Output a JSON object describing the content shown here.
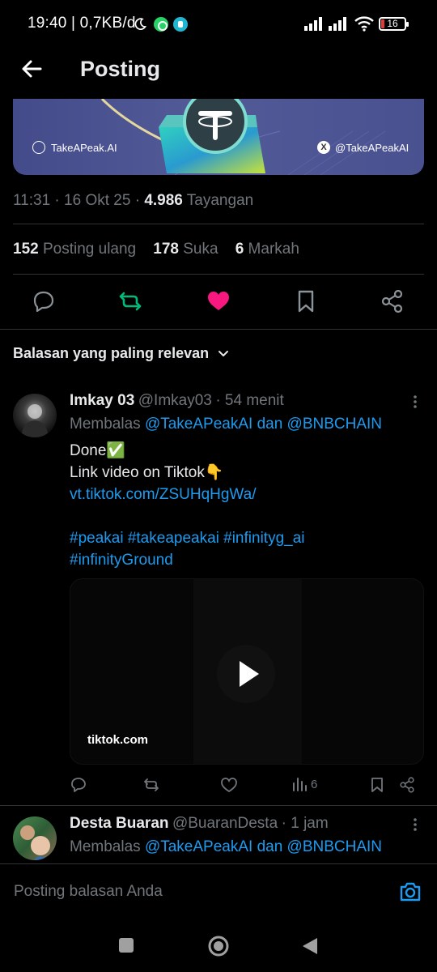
{
  "status_bar": {
    "text": "19:40 | 0,7KB/d",
    "battery": "16"
  },
  "header": {
    "title": "Posting"
  },
  "banner": {
    "website": "TakeAPeak.AI",
    "x_handle": "@TakeAPeakAI"
  },
  "post_meta": {
    "time": "11:31",
    "date": "16 Okt 25",
    "views_count": "4.986",
    "views_label": "Tayangan"
  },
  "post_stats": {
    "reposts_count": "152",
    "reposts_label": "Posting ulang",
    "likes_count": "178",
    "likes_label": "Suka",
    "bookmarks_count": "6",
    "bookmarks_label": "Markah"
  },
  "colors": {
    "accent_blue": "#1d9bf0",
    "repost_green": "#00ba7c",
    "like_pink": "#f91880"
  },
  "replies_filter": {
    "label": "Balasan yang paling relevan"
  },
  "replies": [
    {
      "name": "Imkay 03",
      "handle": "@Imkay03",
      "time": "54 menit",
      "replying_prefix": "Membalas",
      "replying_to": "@TakeAPeakAI dan @BNBCHAIN",
      "line1": "Done✅",
      "line2": "Link video on Tiktok👇",
      "link": "vt.tiktok.com/ZSUHqHgWa/",
      "hashtags1": "#peakai #takeapeakai #infinityg_ai",
      "hashtags2": "#infinityGround",
      "card_domain": "tiktok.com",
      "views": "6"
    },
    {
      "name": "Desta Buaran",
      "handle": "@BuaranDesta",
      "time": "1 jam",
      "replying_prefix": "Membalas",
      "replying_to": "@TakeAPeakAI dan @BNBCHAIN"
    }
  ],
  "compose": {
    "placeholder": "Posting balasan Anda"
  }
}
